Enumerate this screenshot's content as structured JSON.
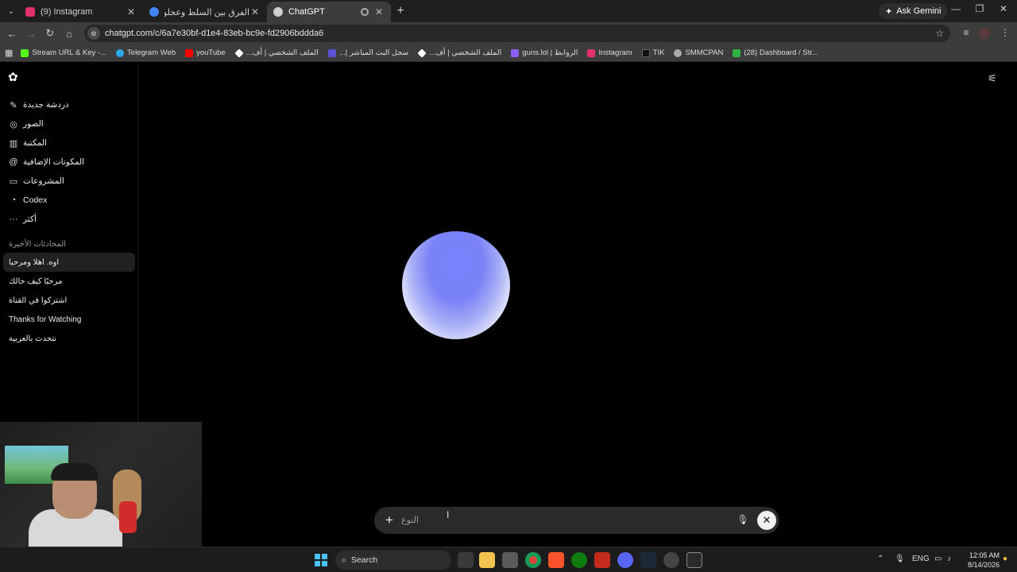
{
  "browser": {
    "tabs": [
      {
        "title": "(9) Instagram",
        "favicon_color": "#e1306c"
      },
      {
        "title": "الفرق بين السلط وعجلون - بحث",
        "favicon_color": "#4285f4"
      },
      {
        "title": "ChatGPT",
        "favicon_color": "#cfcfcf"
      }
    ],
    "new_tab": "+",
    "gemini_label": "Ask Gemini",
    "url": "chatgpt.com/c/6a7e30bf-d1e4-83eb-bc9e-fd2906bddda6",
    "bookmarks": [
      {
        "label": "Stream URL & Key -...",
        "color": "#53fc18"
      },
      {
        "label": "Telegram Web",
        "color": "#2aabee"
      },
      {
        "label": "youTube",
        "color": "#ff0000"
      },
      {
        "label": "الملف الشخصي | أف...",
        "color": "#ffffff"
      },
      {
        "label": "سجل البث المباشر |...",
        "color": "#5b4fd6"
      },
      {
        "label": "الملف الشخصي | أف...",
        "color": "#ffffff"
      },
      {
        "label": "guns.lol | الروابط",
        "color": "#8b5cf6"
      },
      {
        "label": "Instagram",
        "color": "#e1306c"
      },
      {
        "label": "TIK",
        "color": "#111111"
      },
      {
        "label": "SMMCPAN",
        "color": "#aaaaaa"
      },
      {
        "label": "(28) Dashboard / Str...",
        "color": "#2fb344"
      }
    ]
  },
  "sidebar": {
    "nav": [
      {
        "label": "دردشة جديدة",
        "icon": "edit-icon"
      },
      {
        "label": "الصور",
        "icon": "images-icon"
      },
      {
        "label": "المكتبة",
        "icon": "library-icon"
      },
      {
        "label": "المكونات الإضافية",
        "icon": "plugins-icon"
      },
      {
        "label": "المشروعات",
        "icon": "folder-icon"
      },
      {
        "label": "Codex",
        "icon": "codex-icon"
      },
      {
        "label": "أكثر",
        "icon": "more-icon"
      }
    ],
    "recent_title": "المحادثات الأخيرة",
    "chats": [
      "اوه. اهلا ومرحبا",
      "مرحبًا كيف حالك",
      "اشتركوا في القناة",
      "Thanks for Watching",
      "نتحدث بالعربية"
    ]
  },
  "composer": {
    "placeholder": "النوع"
  },
  "taskbar": {
    "search_label": "Search",
    "language": "ENG",
    "time": "12:05 AM",
    "date": "8/14/2026"
  },
  "colors": {
    "orb_top": "#7b83ff",
    "orb_bottom": "#f6f7ff",
    "accent_windows": "#4cc2ff"
  }
}
